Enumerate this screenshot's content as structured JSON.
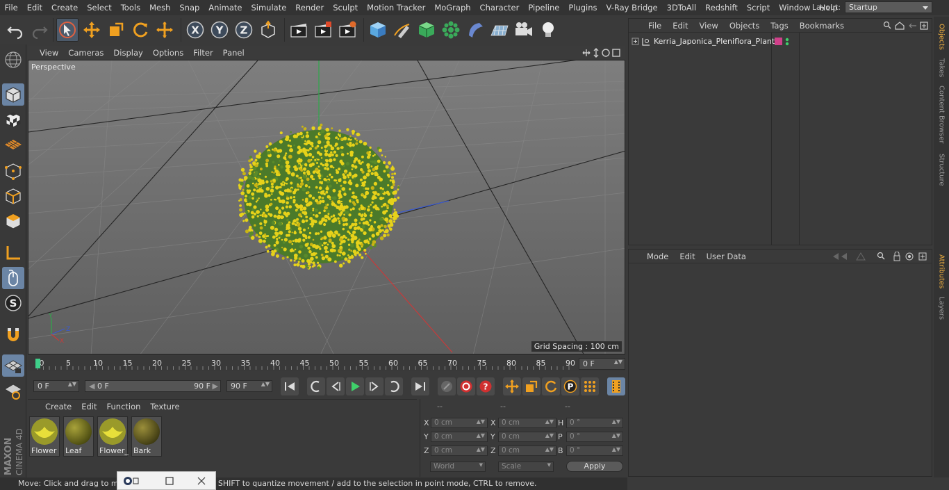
{
  "menubar": {
    "items": [
      "File",
      "Edit",
      "Create",
      "Select",
      "Tools",
      "Mesh",
      "Snap",
      "Animate",
      "Simulate",
      "Render",
      "Sculpt",
      "Motion Tracker",
      "MoGraph",
      "Character",
      "Pipeline",
      "Plugins",
      "V-Ray Bridge",
      "3DToAll",
      "Redshift",
      "Script",
      "Window",
      "Help"
    ],
    "layout_label": "Layout:",
    "layout_value": "Startup"
  },
  "viewport": {
    "menu": [
      "View",
      "Cameras",
      "Display",
      "Options",
      "Filter",
      "Panel"
    ],
    "label": "Perspective",
    "grid_spacing": "Grid Spacing : 100 cm",
    "axis_labels": {
      "y": "Y",
      "z": "Z",
      "x": "X"
    }
  },
  "timeline": {
    "ticks": [
      "0",
      "5",
      "10",
      "15",
      "20",
      "25",
      "30",
      "35",
      "40",
      "45",
      "50",
      "55",
      "60",
      "65",
      "70",
      "75",
      "80",
      "85",
      "90"
    ],
    "current_frame": "0 F"
  },
  "transport": {
    "start_field": "0 F",
    "range_start": "0 F",
    "range_end": "90 F",
    "end_field": "90 F"
  },
  "material_panel": {
    "menu": [
      "Create",
      "Edit",
      "Function",
      "Texture"
    ],
    "materials": [
      "Flower",
      "Leaf",
      "Flower_",
      "Bark"
    ]
  },
  "coord_panel": {
    "headers": [
      "--",
      "--",
      "--"
    ],
    "rows": [
      {
        "a": "X",
        "av": "0 cm",
        "b": "X",
        "bv": "0 cm",
        "c": "H",
        "cv": "0 °"
      },
      {
        "a": "Y",
        "av": "0 cm",
        "b": "Y",
        "bv": "0 cm",
        "c": "P",
        "cv": "0 °"
      },
      {
        "a": "Z",
        "av": "0 cm",
        "b": "Z",
        "bv": "0 cm",
        "c": "B",
        "cv": "0 °"
      }
    ],
    "world": "World",
    "scale": "Scale",
    "apply": "Apply"
  },
  "object_panel": {
    "menu": [
      "File",
      "Edit",
      "View",
      "Objects",
      "Tags",
      "Bookmarks"
    ],
    "object_name": "Kerria_Japonica_Pleniflora_Plant"
  },
  "attr_panel": {
    "menu": [
      "Mode",
      "Edit",
      "User Data"
    ]
  },
  "right_tabs": [
    "Objects",
    "Takes",
    "Content Browser",
    "Structure",
    "Attributes",
    "Layers"
  ],
  "status": "Move: Click and drag to move elements. Hold down SHIFT to quantize movement / add to the selection in point mode, CTRL to remove.",
  "brand": {
    "maxon": "MAXON",
    "product": "CINEMA 4D"
  },
  "colors": {
    "accent": "#6b85a5",
    "flower": "#e6d21a",
    "leaf": "#4b7a2a",
    "axis_y": "#2ea84a",
    "axis_x": "#c83a3a",
    "axis_z": "#3a5ad0"
  }
}
